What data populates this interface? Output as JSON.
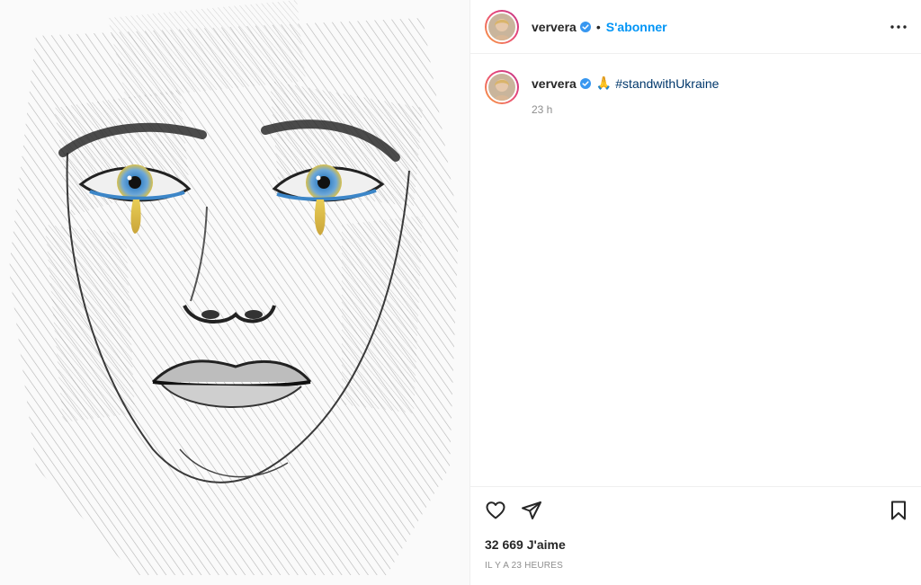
{
  "post": {
    "username": "ververa",
    "follow_label": "S'abonner",
    "separator": "•",
    "caption": {
      "username": "ververa",
      "emoji": "🙏",
      "hashtag": "#standwithUkraine",
      "time": "23 h"
    },
    "likes": "32 669 J'aime",
    "posted": "IL Y A 23 HEURES"
  },
  "icons": {
    "verified": "verified-badge-icon",
    "more": "more-options-icon",
    "like": "heart-icon",
    "share": "paper-plane-icon",
    "save": "bookmark-icon"
  },
  "colors": {
    "accent": "#0095f6",
    "hashtag": "#00376b",
    "tear_yellow": "#e2c33a",
    "eye_blue": "#3c86c8"
  }
}
